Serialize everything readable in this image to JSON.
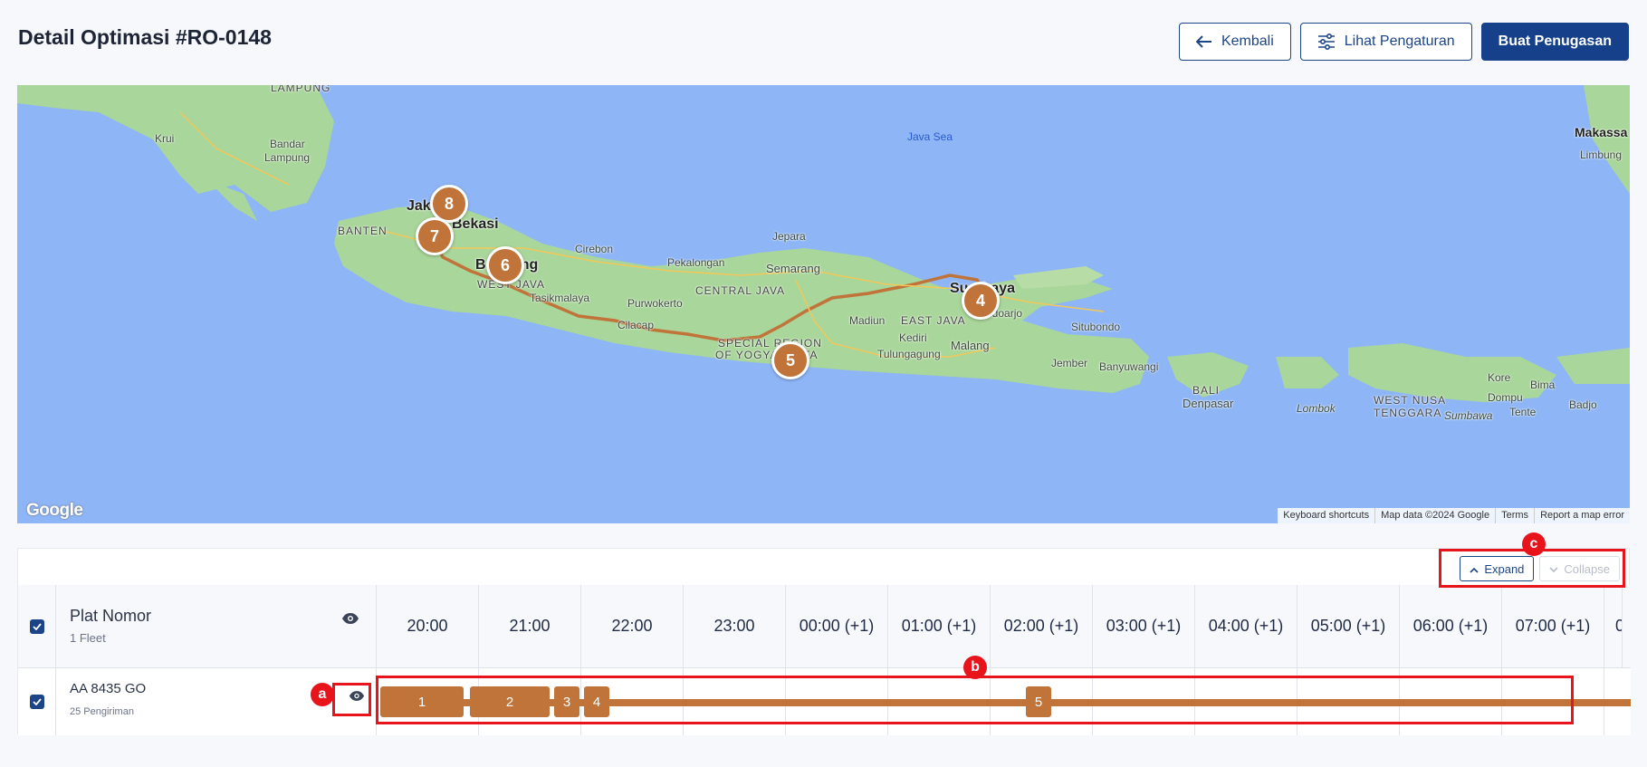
{
  "header": {
    "title": "Detail Optimasi #RO-0148",
    "back_label": "Kembali",
    "settings_label": "Lihat Pengaturan",
    "create_label": "Buat Penugasan"
  },
  "map": {
    "labels": {
      "lampung": "LAMPUNG",
      "krui": "Krui",
      "bandar": "Bandar",
      "lampung_city": "Lampung",
      "java_sea": "Java Sea",
      "makassar": "Makassa",
      "limbung": "Limbung",
      "banten": "BANTEN",
      "jakarta": "Jakarta",
      "bekasi": "Bekasi",
      "bandung": "Bandung",
      "cirebon": "Cirebon",
      "jepara": "Jepara",
      "pekalongan": "Pekalongan",
      "semarang": "Semarang",
      "west_java": "WEST JAVA",
      "central_java": "CENTRAL JAVA",
      "tasikmalaya": "Tasikmalaya",
      "purwokerto": "Purwokerto",
      "cilacap": "Cilacap",
      "special_region": "SPECIAL REGION",
      "of_yogyakarta": "OF YOGYAKARTA",
      "surabaya": "Surabaya",
      "madiun": "Madiun",
      "east_java": "EAST JAVA",
      "sidoarjo": "Sidoarjo",
      "kediri": "Kediri",
      "tulungagung": "Tulungagung",
      "malang": "Malang",
      "situbondo": "Situbondo",
      "jember": "Jember",
      "banyuwangi": "Banyuwangi",
      "bali": "BALI",
      "denpasar": "Denpasar",
      "lombok": "Lombok",
      "west_nusa": "WEST NUSA",
      "tenggara": "TENGGARA",
      "sumbawa": "Sumbawa",
      "kore": "Kore",
      "bima": "Bima",
      "dompu": "Dompu",
      "badjo": "Badjo",
      "tente": "Tente"
    },
    "markers": [
      "8",
      "7",
      "6",
      "5",
      "4"
    ],
    "google": "Google",
    "footer": {
      "shortcuts": "Keyboard shortcuts",
      "data": "Map data ©2024 Google",
      "terms": "Terms",
      "report": "Report a map error"
    },
    "colors": {
      "water": "#8eb5f6",
      "land": "#a9d69a",
      "route": "#c0743a"
    }
  },
  "table": {
    "expand_label": "Expand",
    "collapse_label": "Collapse",
    "header": {
      "title": "Plat Nomor",
      "subtitle": "1 Fleet"
    },
    "times": [
      "20:00",
      "21:00",
      "22:00",
      "23:00",
      "00:00 (+1)",
      "01:00 (+1)",
      "02:00 (+1)",
      "03:00 (+1)",
      "04:00 (+1)",
      "05:00 (+1)",
      "06:00 (+1)",
      "07:00 (+1)",
      "0"
    ],
    "rows": [
      {
        "plate": "AA 8435 GO",
        "deliveries": "25 Pengiriman",
        "segments": [
          "1",
          "2",
          "3",
          "4",
          "5"
        ]
      }
    ]
  },
  "annotations": {
    "a": "a",
    "b": "b",
    "c": "c",
    "color": "#e8141c"
  }
}
